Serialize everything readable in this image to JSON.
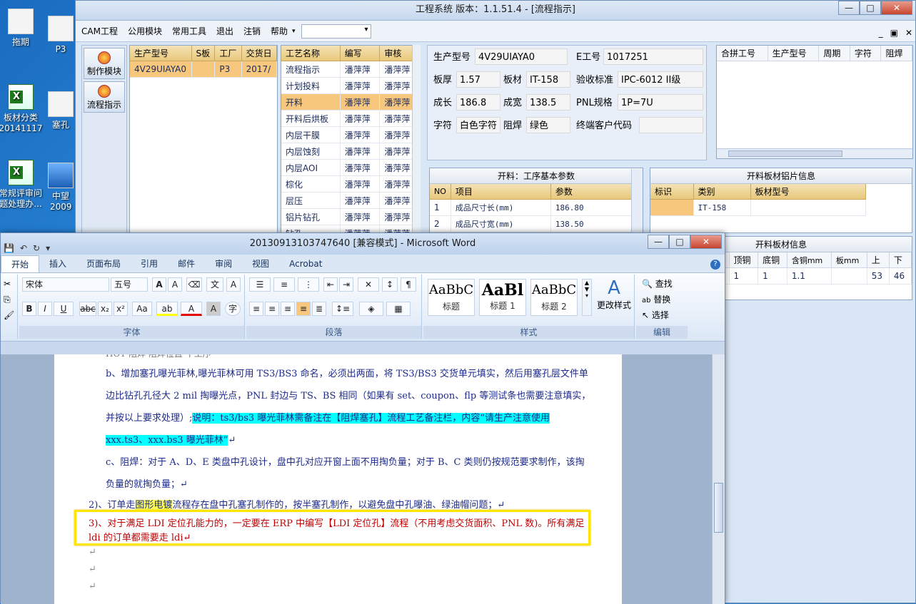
{
  "desktop": {
    "icons": [
      {
        "label": "拖期"
      },
      {
        "label": "P3"
      },
      {
        "label": "板材分类20141117"
      },
      {
        "label": "塞孔"
      },
      {
        "label": "常规评审问题处理办..."
      },
      {
        "label": "中望2009"
      }
    ]
  },
  "cam": {
    "title": "工程系统  版本：1.1.51.4 - [流程指示]",
    "menu": [
      "CAM工程",
      "公用模块",
      "常用工具",
      "退出",
      "注销",
      "帮助"
    ],
    "nav": [
      {
        "label": "制作模块"
      },
      {
        "label": "流程指示"
      }
    ],
    "orders": {
      "headers": [
        "生产型号",
        "S板",
        "工厂",
        "交货日"
      ],
      "rows": [
        [
          "4V29UIAYA0",
          "",
          "P3",
          "2017/"
        ]
      ]
    },
    "process": {
      "headers": [
        "工艺名称",
        "编写",
        "审核"
      ],
      "rows": [
        [
          "流程指示",
          "潘萍萍",
          "潘萍萍"
        ],
        [
          "计划投料",
          "潘萍萍",
          "潘萍萍"
        ],
        [
          "开料",
          "潘萍萍",
          "潘萍萍"
        ],
        [
          "开料后烘板",
          "潘萍萍",
          "潘萍萍"
        ],
        [
          "内层干膜",
          "潘萍萍",
          "潘萍萍"
        ],
        [
          "内层蚀刻",
          "潘萍萍",
          "潘萍萍"
        ],
        [
          "内层AOI",
          "潘萍萍",
          "潘萍萍"
        ],
        [
          "棕化",
          "潘萍萍",
          "潘萍萍"
        ],
        [
          "层压",
          "潘萍萍",
          "潘萍萍"
        ],
        [
          "铝片钻孔",
          "潘萍萍",
          "潘萍萍"
        ],
        [
          "钻孔",
          "潘萍萍",
          "潘萍萍"
        ]
      ]
    },
    "info": {
      "model_label": "生产型号",
      "model": "4V29UIAYA0",
      "eno_label": "E工号",
      "eno": "1017251",
      "thick_label": "板厚",
      "thick": "1.57",
      "mat_label": "板材",
      "mat": "IT-158",
      "std_label": "验收标准",
      "std": "IPC-6012 II级",
      "len_label": "成长",
      "len": "186.8",
      "wid_label": "成宽",
      "wid": "138.5",
      "pnl_label": "PNL规格",
      "pnl": "1P=7U",
      "char_label": "字符",
      "char": "白色字符",
      "mask_label": "阻焊",
      "mask": "绿色",
      "cust_label": "终端客户代码",
      "cust": ""
    },
    "combine": {
      "headers": [
        "合拼工号",
        "生产型号",
        "周期",
        "字符",
        "阻焊"
      ]
    },
    "params": {
      "title": "开料：工序基本参数",
      "headers": [
        "NO",
        "项目",
        "参数"
      ],
      "rows": [
        [
          "1",
          "成品尺寸长(mm)",
          "186.80"
        ],
        [
          "2",
          "成品尺寸宽(mm)",
          "138.50"
        ]
      ]
    },
    "alu": {
      "title": "开料板材铝片信息",
      "headers": [
        "标识",
        "类别",
        "板材型号"
      ],
      "rows": [
        [
          "",
          "IT-158",
          ""
        ]
      ]
    },
    "board": {
      "title": "开料板材信息",
      "headers": [
        "顶铜",
        "底铜",
        "含铜mm",
        "板mm",
        "上",
        "下"
      ],
      "rows": [
        [
          "1",
          "1",
          "1.1",
          "",
          "53",
          "46"
        ]
      ]
    }
  },
  "word": {
    "title": "20130913103747640 [兼容模式] - Microsoft Word",
    "tabs": [
      "开始",
      "插入",
      "页面布局",
      "引用",
      "邮件",
      "审阅",
      "视图",
      "Acrobat"
    ],
    "font_name": "宋体",
    "font_size": "五号",
    "groups": {
      "font": "字体",
      "para": "段落",
      "styles": "样式",
      "edit": "编辑"
    },
    "styles": [
      {
        "sample": "AaBbC",
        "name": "标题"
      },
      {
        "sample": "AaBl",
        "name": "标题 1"
      },
      {
        "sample": "AaBbC",
        "name": "标题 2"
      }
    ],
    "change_style": "更改样式",
    "edit": {
      "find": "查找",
      "replace": "替换",
      "select": "选择"
    },
    "doc": {
      "top_cut": "HOT  阻焊  阻焊位置  十工序",
      "b1": "b、增加塞孔曝光菲林,曝光菲林可用 TS3/BS3 命名，必须出两面，将 TS3/BS3 交货单元填实，然后用塞孔层文件单边比钻孔孔径大 2 mil 掏曝光点，PNL 封边与 TS、BS 相同（如果有 set、coupon、flp 等测试条也需要注意填实，并按以上要求处理）;",
      "b2": "说明：ts3/bs3 曝光菲林需备注在【阻焊塞孔】流程工艺备注栏，内容“请生产注意使用 xxx.ts3、xxx.bs3 曝光菲林”",
      "c": "c、阻焊：对于 A、D、E 类盘中孔设计，盘中孔对应开窗上面不用掏负量；对于 B、C 类则仍按规范要求制作，该掏负量的就掏负量；",
      "p2a": "2)、订单走",
      "p2hl": "图形电镀",
      "p2b": "流程存在盘中孔塞孔制作的，按半塞孔制作，以避免盘中孔曝油、绿油帽问题；",
      "p3": "3)、对于满足 LDI 定位孔能力的，一定要在 ERP 中编写【LDI 定位孔】流程（不用考虑交货面积、PNL 数)。所有满足 ldi 的订单都需要走 ldi",
      "para_mark": "↵"
    }
  }
}
